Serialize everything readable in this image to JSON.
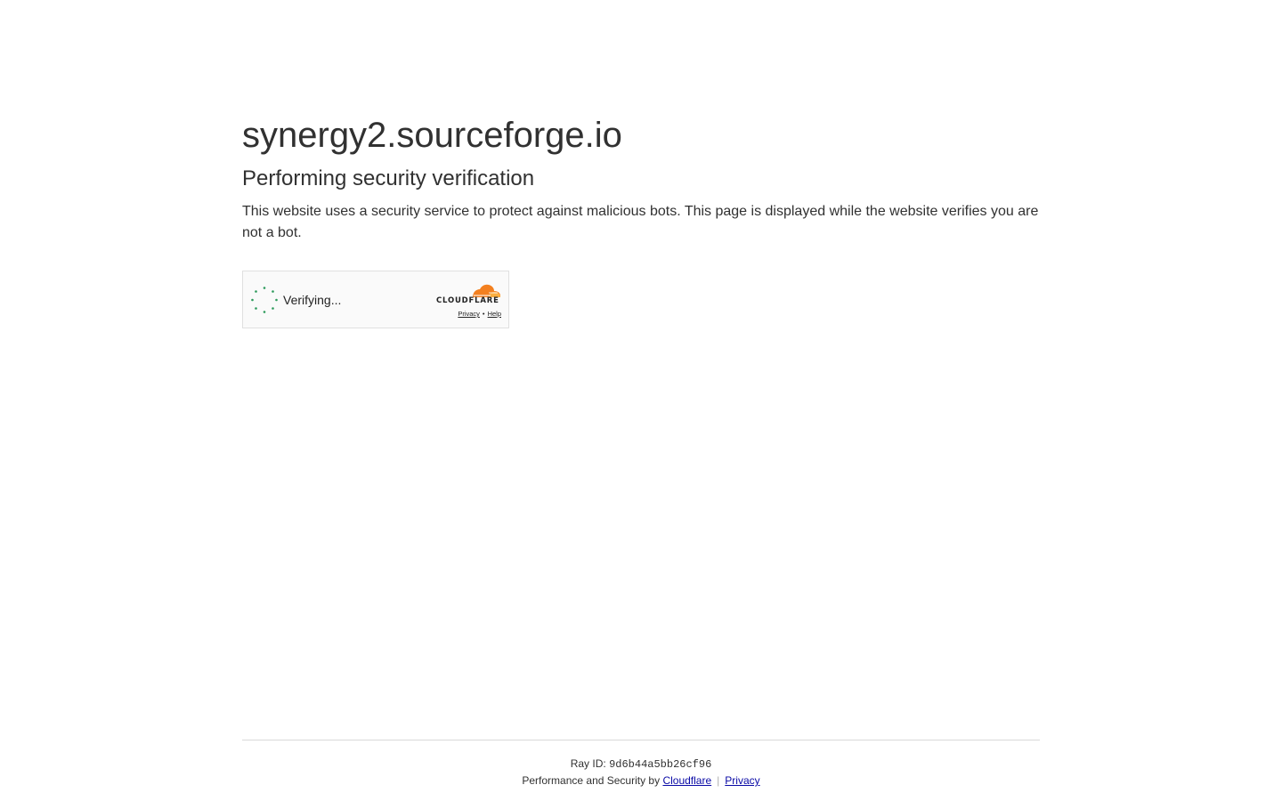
{
  "header": {
    "host": "synergy2.sourceforge.io",
    "subtitle": "Performing security verification",
    "description": "This website uses a security service to protect against malicious bots. This page is displayed while the website verifies you are not a bot."
  },
  "widget": {
    "status_text": "Verifying...",
    "brand": "CLOUDFLARE",
    "privacy_link": "Privacy",
    "link_separator": "•",
    "help_link": "Help",
    "spinner_color": "#2c9a5a",
    "logo_orange": "#f38020",
    "logo_light_orange": "#faae40"
  },
  "footer": {
    "ray_label": "Ray ID:",
    "ray_id": "9d6b44a5bb26cf96",
    "performance_text": "Performance and Security by",
    "cloudflare_link": "Cloudflare",
    "separator": "|",
    "privacy_link": "Privacy"
  }
}
